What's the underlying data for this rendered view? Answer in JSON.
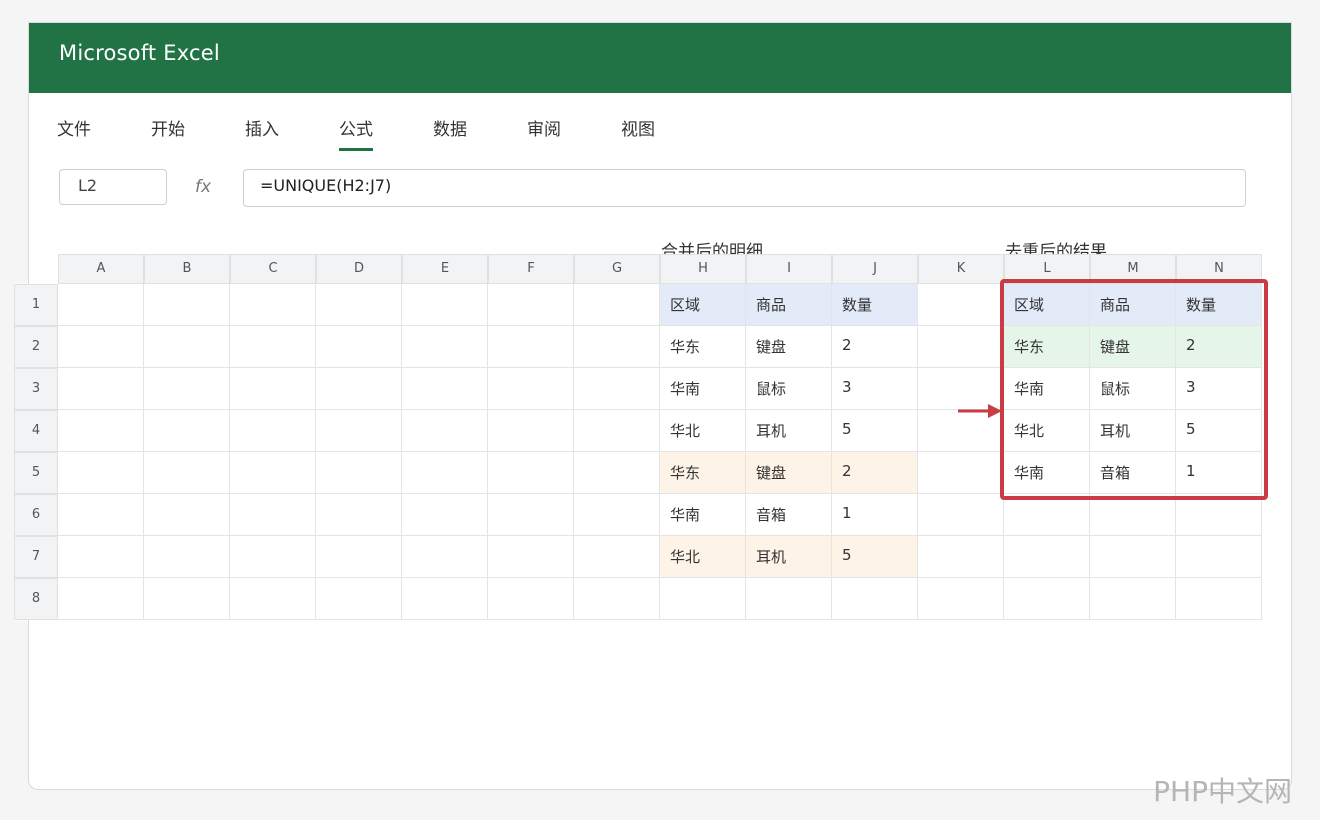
{
  "window": {
    "title": "Microsoft Excel",
    "accent": "#217346"
  },
  "ribbon": {
    "tabs": [
      {
        "label": "文件"
      },
      {
        "label": "开始"
      },
      {
        "label": "插入"
      },
      {
        "label": "公式",
        "active": true
      },
      {
        "label": "数据"
      },
      {
        "label": "审阅"
      },
      {
        "label": "视图"
      }
    ]
  },
  "formula_bar": {
    "name_box": "L2",
    "fx_label": "fx",
    "formula": "=UNIQUE(H2:J7)"
  },
  "captions": {
    "left": "合并后的明细",
    "right": "去重后的结果"
  },
  "grid": {
    "columns": [
      "A",
      "B",
      "C",
      "D",
      "E",
      "F",
      "G",
      "H",
      "I",
      "J",
      "K",
      "L",
      "M",
      "N"
    ],
    "rows": [
      "1",
      "2",
      "3",
      "4",
      "5",
      "6",
      "7",
      "8"
    ]
  },
  "source_table": {
    "headers": [
      "区域",
      "商品",
      "数量"
    ],
    "rows": [
      [
        "华东",
        "键盘",
        "2"
      ],
      [
        "华南",
        "鼠标",
        "3"
      ],
      [
        "华北",
        "耳机",
        "5"
      ],
      [
        "华东",
        "键盘",
        "2"
      ],
      [
        "华南",
        "音箱",
        "1"
      ],
      [
        "华北",
        "耳机",
        "5"
      ]
    ]
  },
  "result_table": {
    "headers": [
      "区域",
      "商品",
      "数量"
    ],
    "rows": [
      [
        "华东",
        "键盘",
        "2"
      ],
      [
        "华南",
        "鼠标",
        "3"
      ],
      [
        "华北",
        "耳机",
        "5"
      ],
      [
        "华南",
        "音箱",
        "1"
      ]
    ]
  },
  "colors": {
    "header_blue": "#e3eaf8",
    "duplicate_orange": "#fdf3e6",
    "unique_green": "#e6f5ea",
    "highlight_red": "#c93b45"
  },
  "watermark": "PHP中文网"
}
